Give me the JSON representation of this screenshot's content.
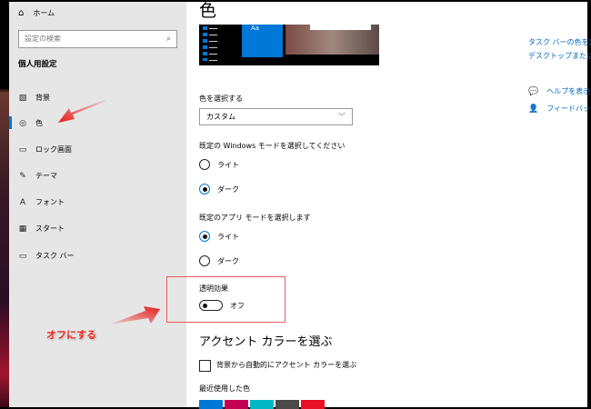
{
  "sidebar": {
    "home": "ホーム",
    "search_placeholder": "設定の検索",
    "section": "個人用設定",
    "items": [
      {
        "label": "背景",
        "icon": "image-icon"
      },
      {
        "label": "色",
        "icon": "palette-icon"
      },
      {
        "label": "ロック画面",
        "icon": "lock-screen-icon"
      },
      {
        "label": "テーマ",
        "icon": "theme-icon"
      },
      {
        "label": "フォント",
        "icon": "font-icon"
      },
      {
        "label": "スタート",
        "icon": "start-icon"
      },
      {
        "label": "タスク バー",
        "icon": "taskbar-icon"
      }
    ],
    "selected": "色"
  },
  "main": {
    "title": "色",
    "preview_text": "Aa",
    "choose_color_label": "色を選択する",
    "choose_color_value": "カスタム",
    "windows_mode_label": "既定の Windows モードを選択してください",
    "windows_mode_options": [
      "ライト",
      "ダーク"
    ],
    "windows_mode_selected": "ダーク",
    "app_mode_label": "既定のアプリ モードを選択します",
    "app_mode_options": [
      "ライト",
      "ダーク"
    ],
    "app_mode_selected": "ライト",
    "transparency_label": "透明効果",
    "transparency_state": "オフ",
    "accent_heading": "アクセント カラーを選ぶ",
    "auto_accent_label": "背景から自動的にアクセント カラーを選ぶ",
    "recent_colors_label": "最近使用した色",
    "recent_colors": [
      "#0078d7",
      "#c30052",
      "#00b7c3",
      "#4c4a48",
      "#e81123"
    ]
  },
  "related": {
    "links": [
      "タスク バーの色を変更",
      "デスクトップまたは背"
    ],
    "help": "ヘルプを表示",
    "feedback": "フィードバックの"
  },
  "annotation": {
    "text": "オフにする",
    "color": "#e8231c"
  }
}
